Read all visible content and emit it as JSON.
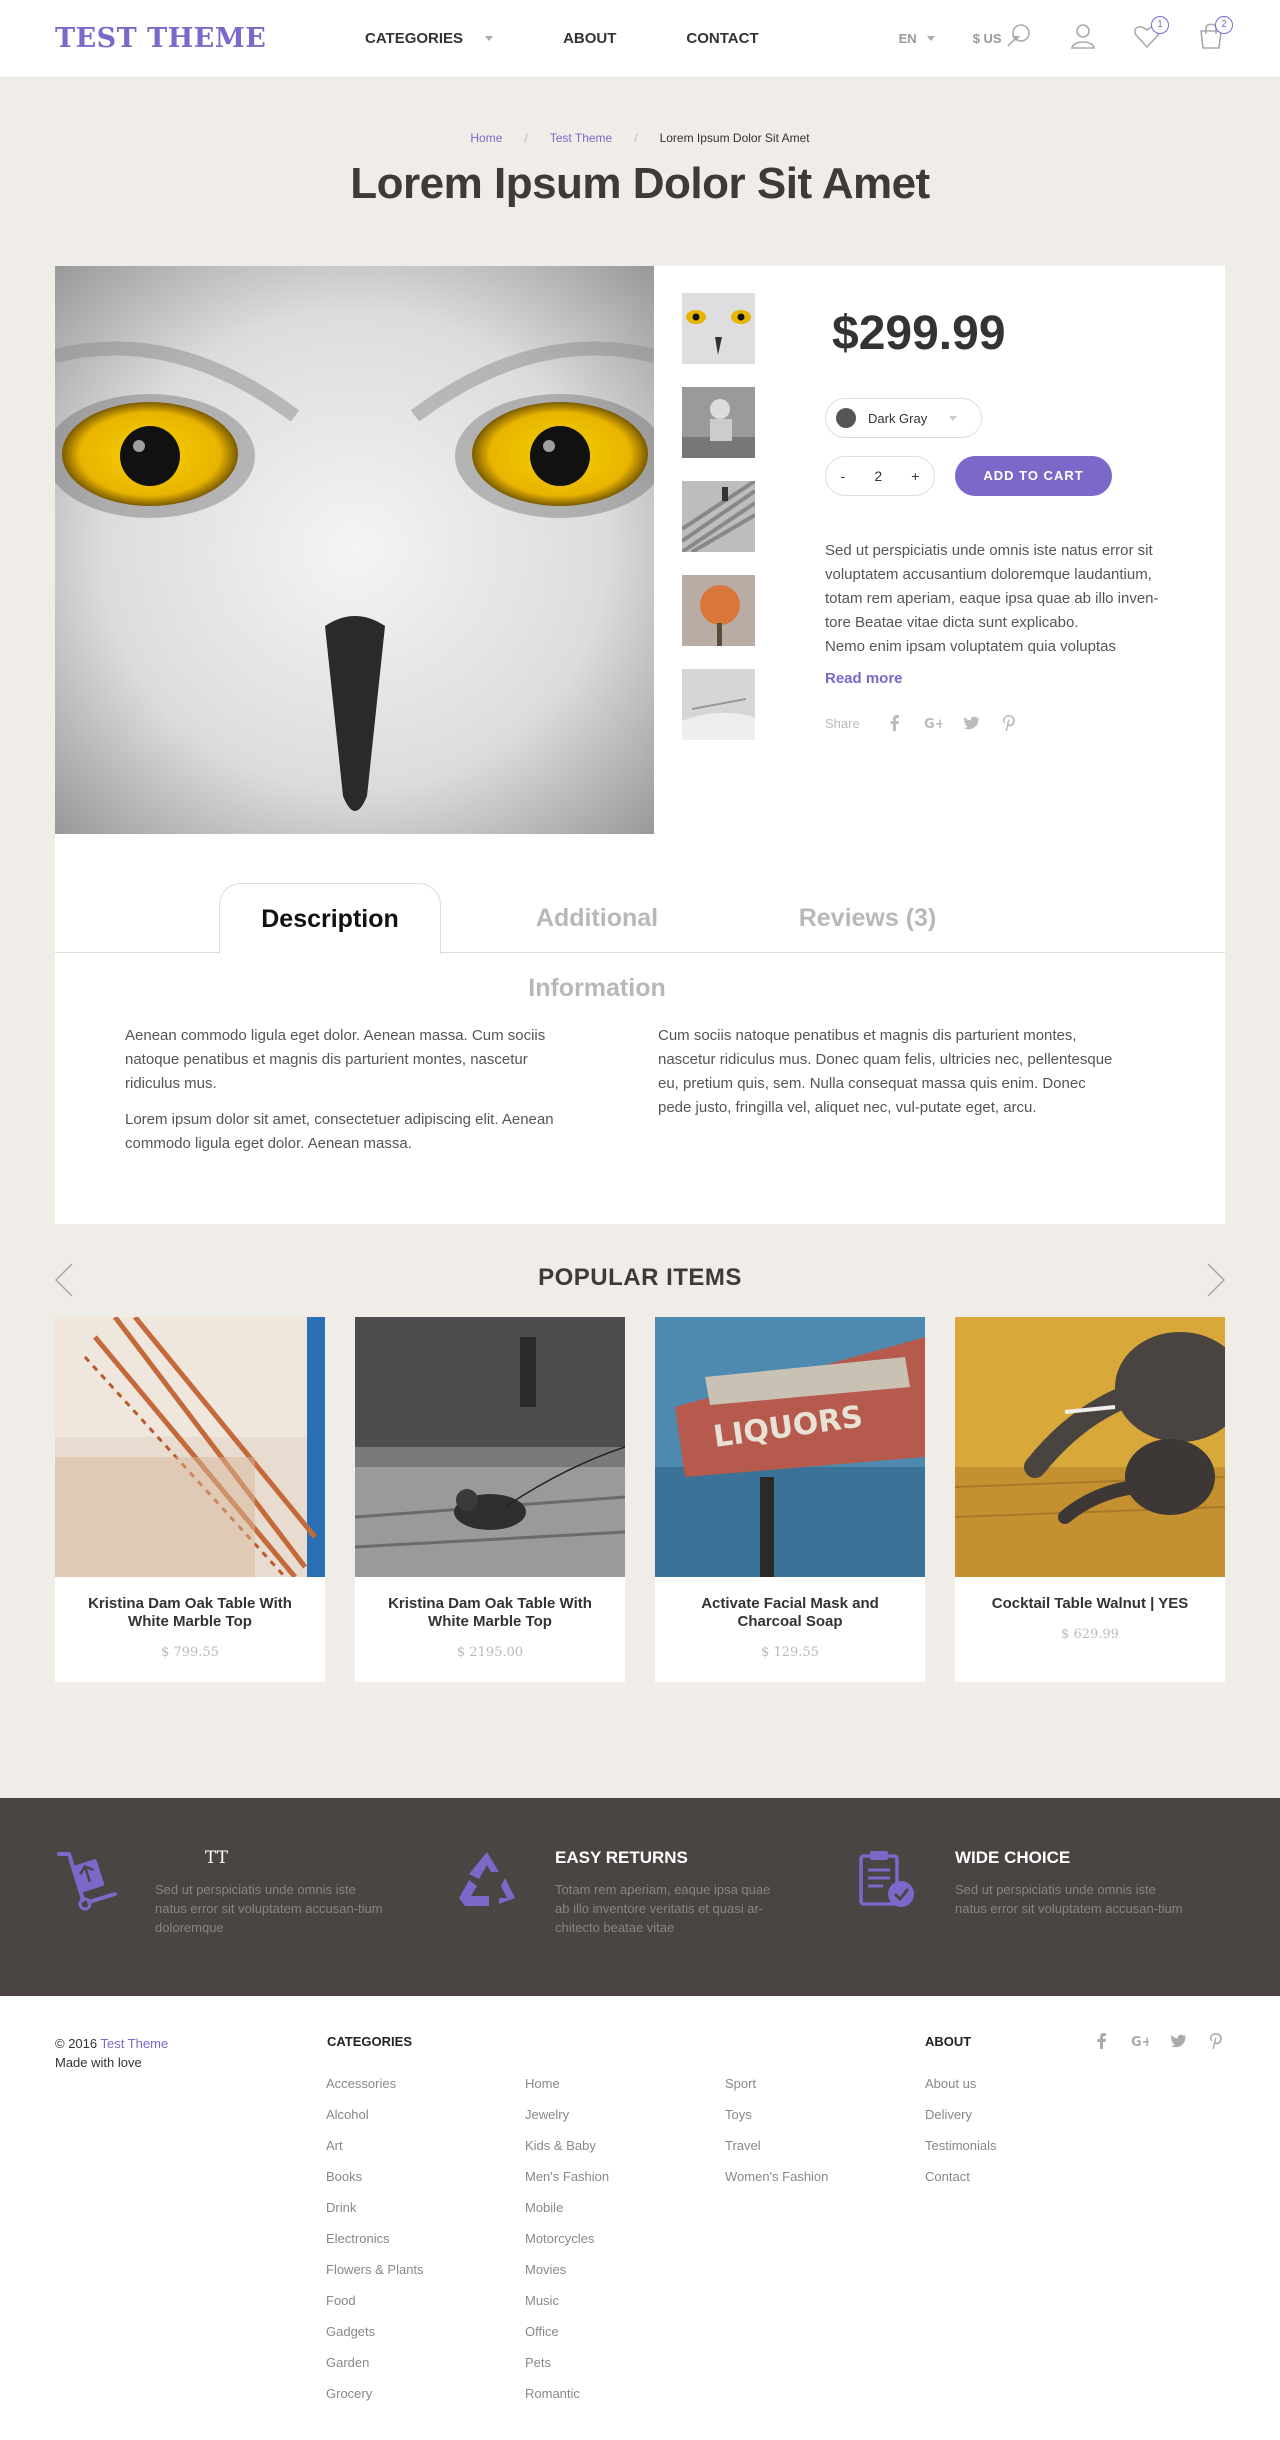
{
  "header": {
    "logo": "TEST THEME",
    "nav": [
      "CATEGORIES",
      "ABOUT",
      "CONTACT"
    ],
    "language": "EN",
    "currency": "$ US",
    "wishlist_count": "1",
    "cart_count": "2",
    "icons": [
      "search-icon",
      "user-icon",
      "heart-icon",
      "shopping-bag-icon"
    ]
  },
  "breadcrumb": [
    "Home",
    "Test Theme",
    "Lorem Ipsum Dolor Sit Amet"
  ],
  "page_title": "Lorem Ipsum Dolor Sit Amet",
  "product": {
    "price": "$299.99",
    "color_option": "Dark Gray",
    "quantity": "2",
    "qty_minus": "-",
    "qty_plus": "+",
    "add_to_cart": "ADD TO CART",
    "short_description": [
      "Sed ut perspiciatis unde omnis iste natus error sit",
      "voluptatem accusantium doloremque laudantium,",
      "totam rem aperiam, eaque ipsa quae ab illo inven-",
      "tore Beatae vitae dicta sunt explicabo.",
      "Nemo enim ipsam voluptatem quia voluptas"
    ],
    "read_more": "Read more",
    "share_label": "Share"
  },
  "tabs": {
    "items": [
      "Description",
      "Additional Information",
      "Reviews (3)"
    ],
    "active": "Description",
    "left_paragraphs": [
      "Aenean commodo ligula eget dolor. Aenean massa. Cum sociis natoque penatibus et magnis dis parturient montes, nascetur ridiculus mus.",
      "Lorem ipsum dolor sit amet, consectetuer adipiscing elit. Aenean commodo ligula eget dolor. Aenean massa."
    ],
    "right_paragraph": "Cum sociis natoque penatibus et magnis dis parturient montes, nascetur ridiculus mus. Donec quam felis, ultricies nec, pellentesque eu, pretium quis, sem. Nulla consequat massa quis enim. Donec pede justo, fringilla vel, aliquet nec, vul-putate eget, arcu."
  },
  "popular": {
    "title": "POPULAR ITEMS",
    "items": [
      {
        "title": "Kristina Dam Oak Table With White Marble Top",
        "price": "$ 799.55"
      },
      {
        "title": "Kristina Dam Oak Table With White Marble Top",
        "price": "$ 2195.00"
      },
      {
        "title": "Activate Facial Mask and Charcoal Soap",
        "price": "$ 129.55"
      },
      {
        "title": "Cocktail Table Walnut | YES",
        "price": "$ 629.99"
      }
    ]
  },
  "features": [
    {
      "title": "TT",
      "text": "Sed ut perspiciatis unde omnis iste natus error sit voluptatem accusan-tium doloremque"
    },
    {
      "title": "EASY RETURNS",
      "text": "Totam rem aperiam, eaque ipsa quae ab illo inventore veritatis et quasi ar-chitecto beatae vitae"
    },
    {
      "title": "WIDE CHOICE",
      "text": "Sed ut perspiciatis unde omnis iste natus error sit voluptatem accusan-tium"
    }
  ],
  "footer": {
    "copyright": "© 2016",
    "brand": "Test Theme",
    "made_with": "Made with love",
    "categories_heading": "CATEGORIES",
    "about_heading": "ABOUT",
    "categories_col1": [
      "Accessories",
      "Alcohol",
      "Art",
      "Books",
      "Drink",
      "Electronics",
      "Flowers & Plants",
      "Food",
      "Gadgets",
      "Garden",
      "Grocery"
    ],
    "categories_col2": [
      "Home",
      "Jewelry",
      "Kids & Baby",
      "Men's Fashion",
      "Mobile",
      "Motorcycles",
      "Movies",
      "Music",
      "Office",
      "Pets",
      "Romantic"
    ],
    "categories_col3": [
      "Sport",
      "Toys",
      "Travel",
      "Women's Fashion"
    ],
    "about_links": [
      "About us",
      "Delivery",
      "Testimonials",
      "Contact"
    ]
  },
  "colors": {
    "accent": "#7b68c9",
    "page_bg": "#f0ece8",
    "dark_band": "#4a4543"
  }
}
